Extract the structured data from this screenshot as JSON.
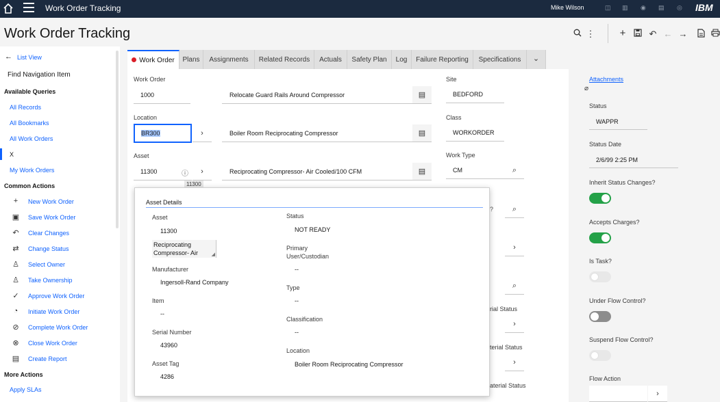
{
  "topbar": {
    "app_title": "Work Order Tracking",
    "user": "Mike Wilson",
    "brand": "IBM"
  },
  "header": {
    "title": "Work Order Tracking"
  },
  "sidebar": {
    "list_view": "List View",
    "find_nav": "Find Navigation Item",
    "available_queries": "Available Queries",
    "queries": [
      "All Records",
      "All Bookmarks",
      "All Work Orders",
      "X",
      "My Work Orders"
    ],
    "common_actions": "Common Actions",
    "actions": [
      {
        "label": "New Work Order",
        "icon": "plus-icon"
      },
      {
        "label": "Save Work Order",
        "icon": "save-icon"
      },
      {
        "label": "Clear Changes",
        "icon": "undo-icon"
      },
      {
        "label": "Change Status",
        "icon": "swap-icon"
      },
      {
        "label": "Select Owner",
        "icon": "user-icon"
      },
      {
        "label": "Take Ownership",
        "icon": "user-add-icon"
      },
      {
        "label": "Approve Work Order",
        "icon": "checkmark-icon"
      },
      {
        "label": "Initiate Work Order",
        "icon": "pie-icon"
      },
      {
        "label": "Complete Work Order",
        "icon": "check-circle-icon"
      },
      {
        "label": "Close Work Order",
        "icon": "close-circle-icon"
      },
      {
        "label": "Create Report",
        "icon": "report-icon"
      }
    ],
    "more_actions": "More Actions",
    "more": [
      "Apply SLAs"
    ]
  },
  "tabs": [
    "Work Order",
    "Plans",
    "Assignments",
    "Related Records",
    "Actuals",
    "Safety Plan",
    "Log",
    "Failure Reporting",
    "Specifications"
  ],
  "form": {
    "work_order_label": "Work Order",
    "work_order": "1000",
    "description": "Relocate Guard Rails Around Compressor",
    "location_label": "Location",
    "location": "BR300",
    "location_desc": "Boiler Room Reciprocating Compressor",
    "asset_label": "Asset",
    "asset": "11300",
    "asset_desc": "Reciprocating Compressor- Air Cooled/100 CFM",
    "asset_tooltip": "11300",
    "site_label": "Site",
    "site": "BEDFORD",
    "class_label": "Class",
    "class": "WORKORDER",
    "work_type_label": "Work Type",
    "work_type": "CM",
    "partial_1": "?",
    "material_status_1": "rial Status",
    "material_status_2": "terial Status",
    "material_status_3": "aterial Status"
  },
  "asset_details": {
    "title": "Asset Details",
    "asset_label": "Asset",
    "asset": "11300",
    "asset_desc": "Reciprocating Compressor- Air",
    "manufacturer_label": "Manufacturer",
    "manufacturer": "Ingersoll-Rand Company",
    "item_label": "Item",
    "item": "--",
    "serial_label": "Serial Number",
    "serial": "43960",
    "tag_label": "Asset Tag",
    "tag": "4286",
    "status_label": "Status",
    "status": "NOT READY",
    "primary_label": "Primary User/Custodian",
    "primary": "--",
    "type_label": "Type",
    "type": "--",
    "classification_label": "Classification",
    "classification": "--",
    "location_label": "Location",
    "location": "Boiler Room Reciprocating Compressor"
  },
  "right": {
    "attachments": "Attachments",
    "status_label": "Status",
    "status": "WAPPR",
    "status_date_label": "Status Date",
    "status_date": "2/6/99 2:25 PM",
    "inherit_label": "Inherit Status Changes?",
    "inherit": true,
    "accepts_label": "Accepts Charges?",
    "accepts": true,
    "is_task_label": "Is Task?",
    "is_task": false,
    "flow_label": "Under Flow Control?",
    "flow": false,
    "suspend_label": "Suspend Flow Control?",
    "suspend": false,
    "flow_action_label": "Flow Action"
  },
  "colors": {
    "topbar": "#1b2a3f",
    "link": "#0f62fe",
    "toggle_on": "#24a148",
    "status_dot": "#da1e28"
  }
}
